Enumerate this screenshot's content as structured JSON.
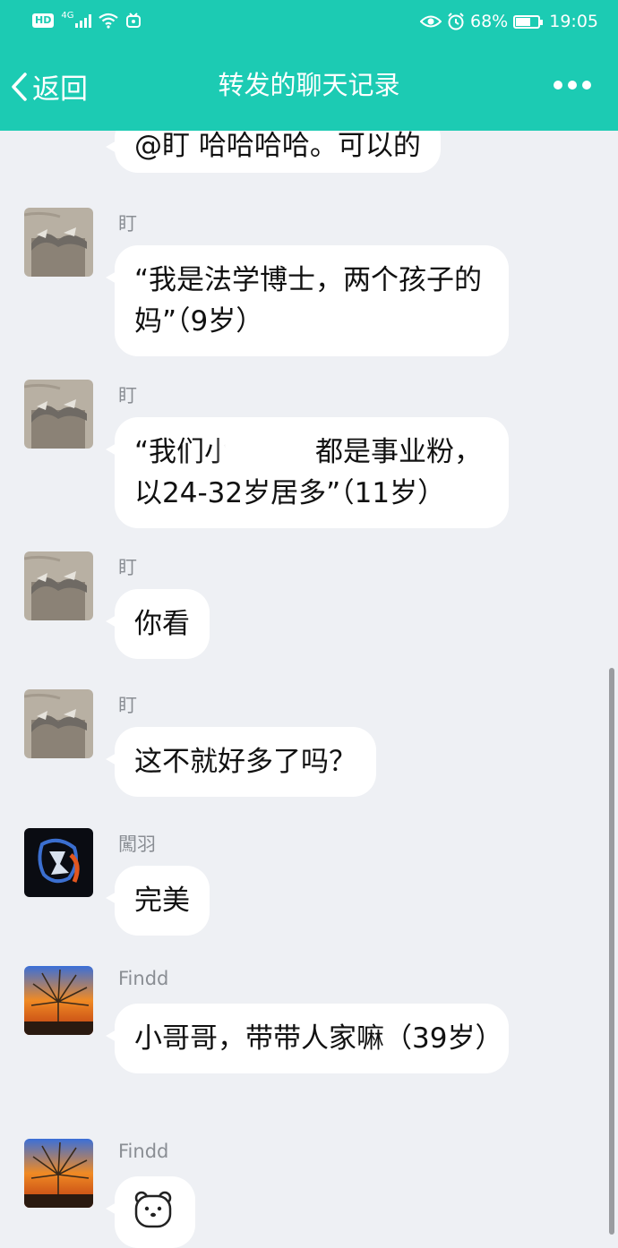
{
  "status_bar": {
    "network": "4G",
    "hd": "HD",
    "battery": "68%",
    "battery_level": 0.68,
    "time": "19:05"
  },
  "header": {
    "back_label": "返回",
    "title": "转发的聊天记录"
  },
  "messages": [
    {
      "text": "@盯 哈哈哈哈。可以的"
    },
    {
      "sender": "盯",
      "text": "“我是法学博士，两个孩子的妈”（9岁）"
    },
    {
      "sender": "盯",
      "text": "“我们小　　　都是事业粉，以24-32岁居多”（11岁）"
    },
    {
      "sender": "盯",
      "text": "你看"
    },
    {
      "sender": "盯",
      "text": "这不就好多了吗？"
    },
    {
      "sender": "闖羽",
      "text": "完美"
    },
    {
      "sender": "Findd",
      "text": "小哥哥，带带人家嘛（39岁）"
    },
    {
      "sender": "Findd",
      "sticker": "bear-emoji"
    }
  ],
  "colors": {
    "accent": "#1ccbb3",
    "background": "#eef0f4",
    "bubble": "#ffffff"
  }
}
